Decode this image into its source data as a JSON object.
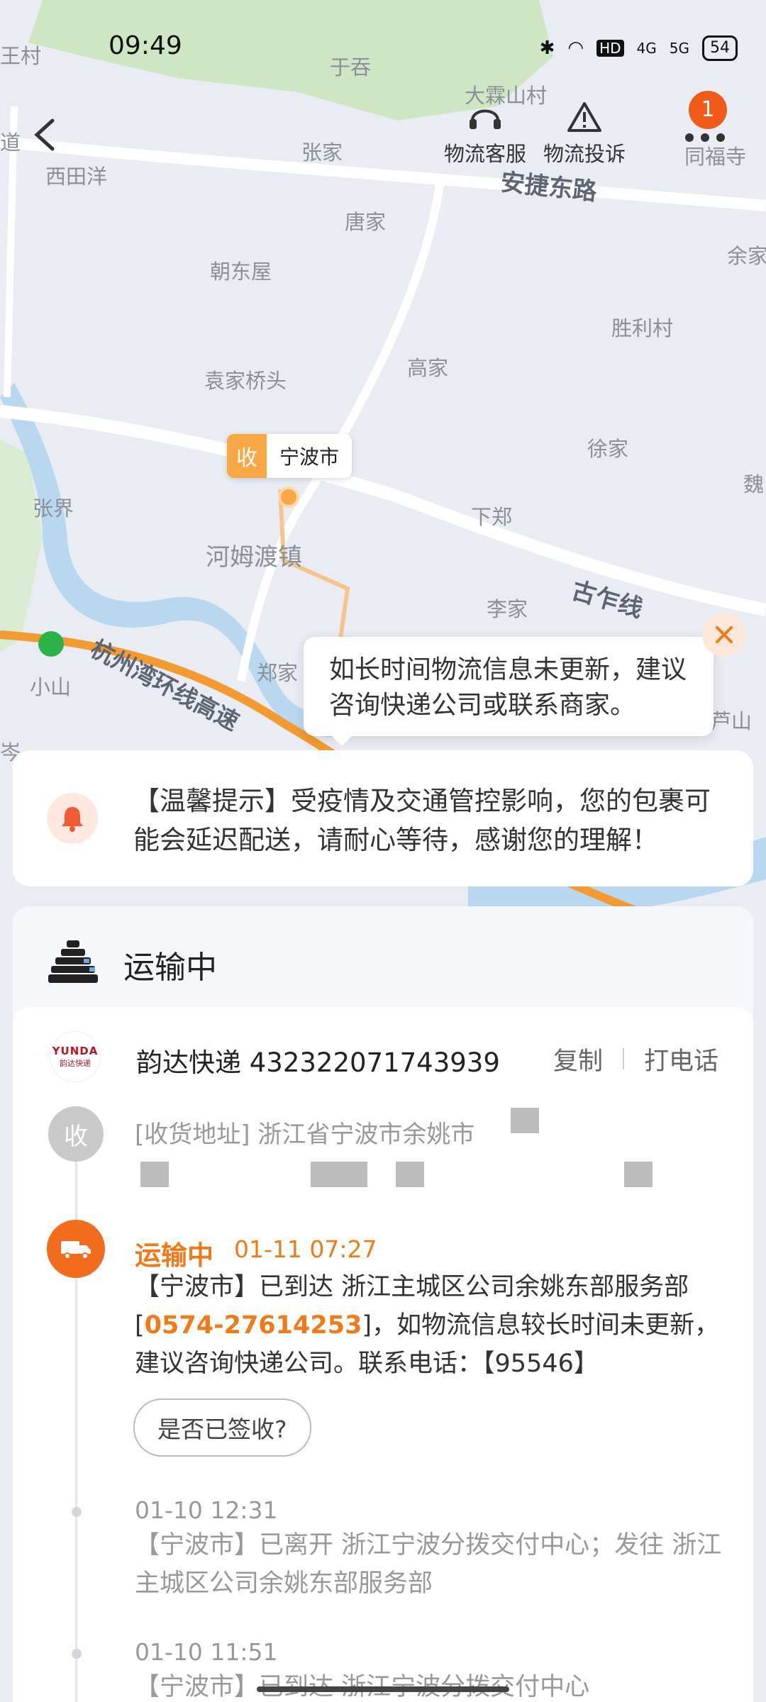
{
  "status_bar": {
    "time": "09:49",
    "network_hd": "HD",
    "network_4g": "4G",
    "network_5g": "5G",
    "battery": "54"
  },
  "nav": {
    "service_label": "物流客服",
    "complaint_label": "物流投诉",
    "badge_count": "1"
  },
  "map": {
    "labels": [
      "王村",
      "于吞",
      "大霖山村",
      "道",
      "西田洋",
      "张家",
      "同福寺",
      "唐家",
      "余家",
      "朝东屋",
      "胜利村",
      "高家",
      "袁家桥头",
      "徐家",
      "魏",
      "张界",
      "下郑",
      "河姆渡镇",
      "李家",
      "郑家",
      "小山",
      "芦山",
      "岑"
    ],
    "roads": [
      "安捷东路",
      "古乍线",
      "杭州湾环线高速"
    ],
    "receiver_tag": "收",
    "receiver_city": "宁波市"
  },
  "tooltip": {
    "text": "如长时间物流信息未更新，建议咨询快递公司或联系商家。"
  },
  "notice": {
    "text": "【温馨提示】受疫情及交通管控影响，您的包裹可能会延迟配送，请耐心等待，感谢您的理解！"
  },
  "shipment": {
    "status_title": "运输中",
    "carrier_logo_top": "YUNDA",
    "carrier_logo_bottom": "韵达快递",
    "carrier": "韵达快递 432322071743939",
    "copy_label": "复制",
    "call_label": "打电话",
    "receive_tag": "收",
    "address_prefix": "[收货地址] 浙江省宁波市余姚市"
  },
  "timeline": {
    "current": {
      "status": "运输中",
      "time": "01-11 07:27",
      "desc_before": "【宁波市】已到达 浙江主城区公司余姚东部服务部[",
      "phone": "0574-27614253",
      "desc_after": "]，如物流信息较长时间未更新，建议咨询快递公司。联系电话：【95546】",
      "signed_button": "是否已签收?"
    },
    "history": [
      {
        "time": "01-10 12:31",
        "desc": "【宁波市】已离开 浙江宁波分拨交付中心；发往 浙江主城区公司余姚东部服务部"
      },
      {
        "time": "01-10 11:51",
        "desc": "【宁波市】已到达 浙江宁波分拨交付中心"
      }
    ]
  }
}
